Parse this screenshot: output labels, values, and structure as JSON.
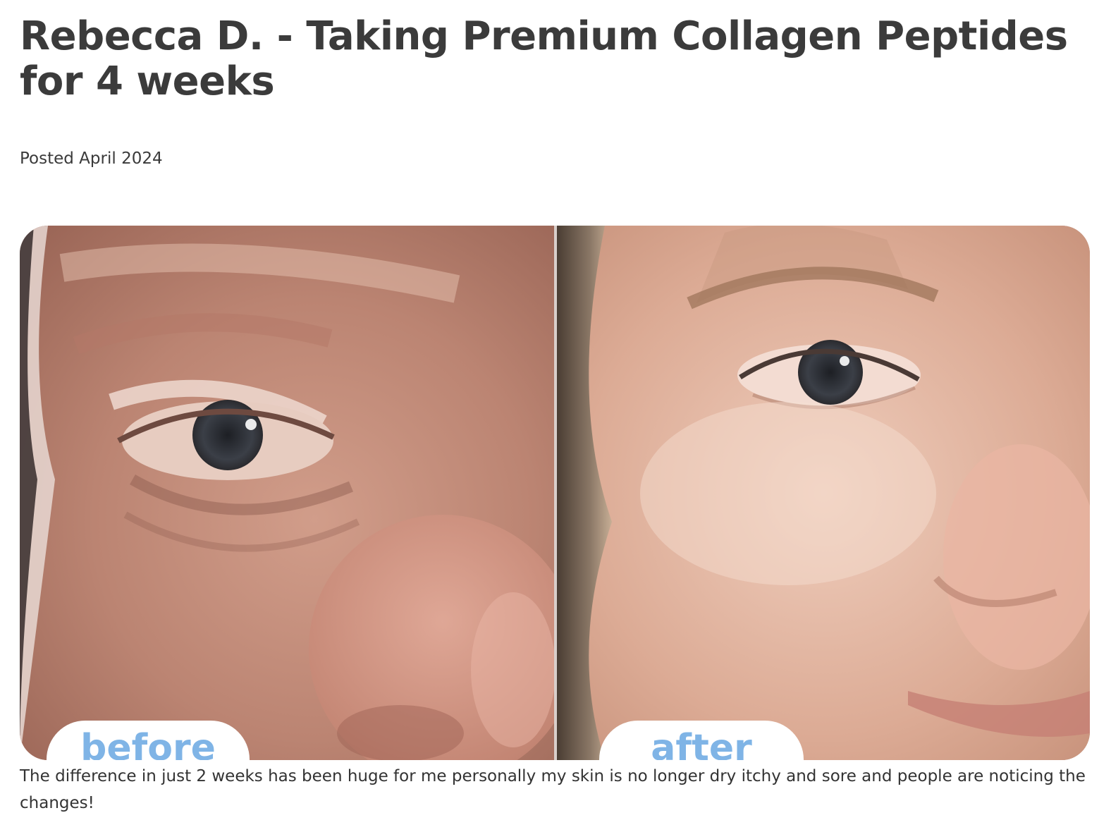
{
  "review": {
    "title": "Rebecca D. - Taking Premium Collagen Peptides for 4 weeks",
    "posted": "Posted April 2024",
    "before_label": "before",
    "after_label": "after",
    "body": "The difference in just 2 weeks has been huge for me personally my skin is no longer dry itchy and sore and people are noticing the changes!"
  },
  "colors": {
    "title": "#3b3b3b",
    "text": "#333333",
    "badge_label": "#7fb4e6",
    "badge_bg": "#ffffff"
  }
}
